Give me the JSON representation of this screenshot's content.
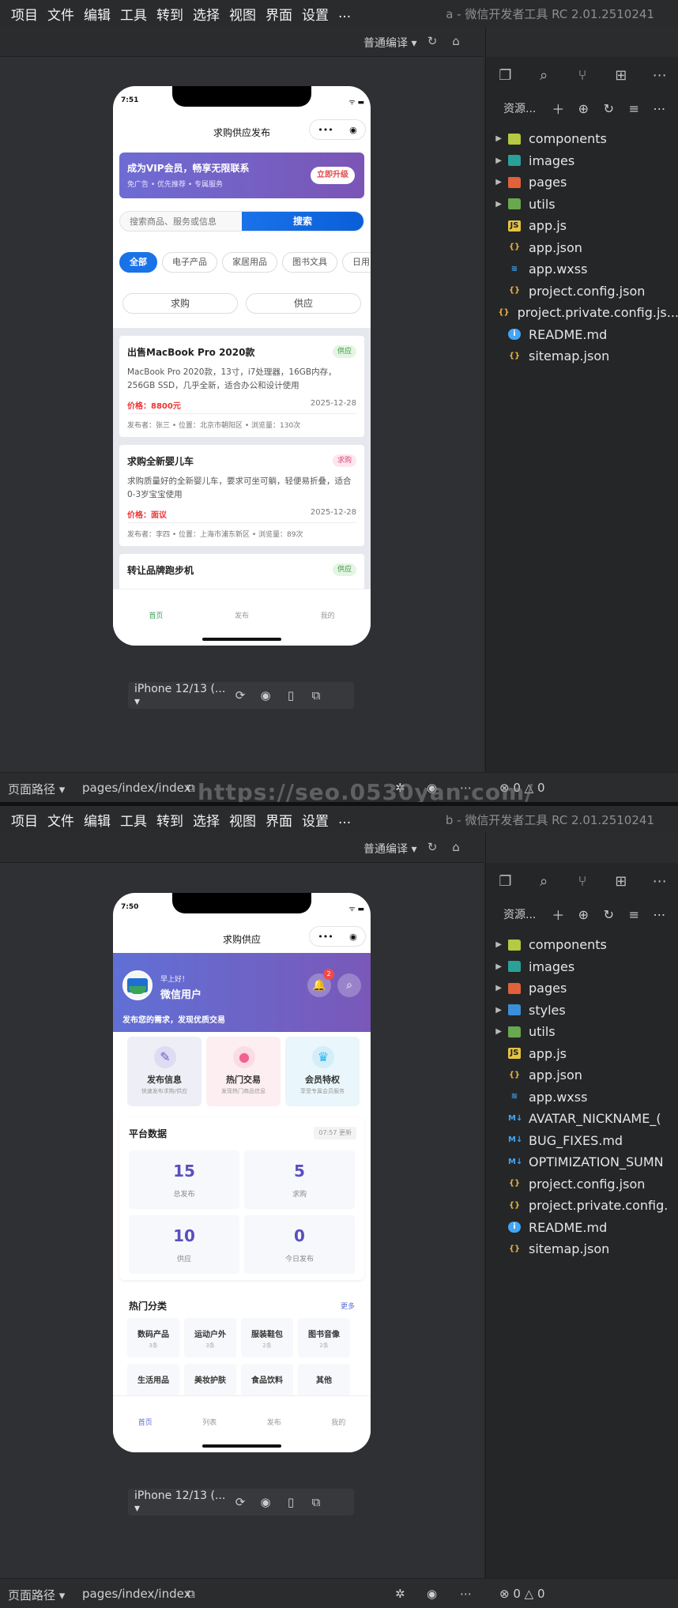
{
  "menu": [
    "项目",
    "文件",
    "编辑",
    "工具",
    "转到",
    "选择",
    "视图",
    "界面",
    "设置",
    "..."
  ],
  "compile_mode": "普通编译",
  "file_panel_title": "资源...",
  "statusbar": {
    "route_label": "页面路径",
    "route": "pages/index/index",
    "problems": "0",
    "warnings": "0"
  },
  "device_name": "iPhone 12/13 (...",
  "watermark": "https://seo.0530yan.com/",
  "window_a": {
    "title": "a - 微信开发者工具 RC 2.01.2510241",
    "files": [
      {
        "name": "components",
        "type": "folder",
        "color": "#b5c942"
      },
      {
        "name": "images",
        "type": "folder",
        "color": "#2aa198"
      },
      {
        "name": "pages",
        "type": "folder",
        "color": "#e0613a"
      },
      {
        "name": "utils",
        "type": "folder",
        "color": "#6aa84f"
      },
      {
        "name": "app.js",
        "type": "js"
      },
      {
        "name": "app.json",
        "type": "json"
      },
      {
        "name": "app.wxss",
        "type": "css"
      },
      {
        "name": "project.config.json",
        "type": "json"
      },
      {
        "name": "project.private.config.js...",
        "type": "json"
      },
      {
        "name": "README.md",
        "type": "info"
      },
      {
        "name": "sitemap.json",
        "type": "json"
      }
    ],
    "phone": {
      "time": "7:51",
      "nav_title": "求购供应发布",
      "vip": {
        "title": "成为VIP会员，畅享无限联系",
        "subtitle": "免广告 • 优先推荐 • 专属服务",
        "button": "立即升级"
      },
      "search": {
        "placeholder": "搜索商品、服务或信息",
        "button": "搜索"
      },
      "categories": [
        "全部",
        "电子产品",
        "家居用品",
        "图书文具",
        "日用"
      ],
      "segments": [
        "求购",
        "供应"
      ],
      "posts": [
        {
          "title": "出售MacBook Pro 2020款",
          "tag": "供应",
          "desc": "MacBook Pro 2020款，13寸，i7处理器，16GB内存，256GB SSD，几乎全新，适合办公和设计使用",
          "price": "价格：8800元",
          "date": "2025-12-28",
          "meta": "发布者：张三 • 位置：北京市朝阳区 • 浏览量：130次"
        },
        {
          "title": "求购全新婴儿车",
          "tag": "求购",
          "desc": "求购质量好的全新婴儿车，要求可坐可躺，轻便易折叠，适合0-3岁宝宝使用",
          "price": "价格：面议",
          "date": "2025-12-28",
          "meta": "发布者：李四 • 位置：上海市浦东新区 • 浏览量：89次"
        },
        {
          "title": "转让品牌跑步机",
          "tag": "供应",
          "desc": "",
          "price": "",
          "date": "",
          "meta": ""
        }
      ],
      "tabs": [
        "首页",
        "发布",
        "我的"
      ]
    }
  },
  "window_b": {
    "title": "b - 微信开发者工具 RC 2.01.2510241",
    "files": [
      {
        "name": "components",
        "type": "folder",
        "color": "#b5c942"
      },
      {
        "name": "images",
        "type": "folder",
        "color": "#2aa198"
      },
      {
        "name": "pages",
        "type": "folder",
        "color": "#e0613a"
      },
      {
        "name": "styles",
        "type": "folder",
        "color": "#3b8fd9"
      },
      {
        "name": "utils",
        "type": "folder",
        "color": "#6aa84f"
      },
      {
        "name": "app.js",
        "type": "js"
      },
      {
        "name": "app.json",
        "type": "json"
      },
      {
        "name": "app.wxss",
        "type": "css"
      },
      {
        "name": "AVATAR_NICKNAME_(",
        "type": "md"
      },
      {
        "name": "BUG_FIXES.md",
        "type": "md"
      },
      {
        "name": "OPTIMIZATION_SUMN",
        "type": "md"
      },
      {
        "name": "project.config.json",
        "type": "json"
      },
      {
        "name": "project.private.config.",
        "type": "json"
      },
      {
        "name": "README.md",
        "type": "info"
      },
      {
        "name": "sitemap.json",
        "type": "json"
      }
    ],
    "phone": {
      "time": "7:50",
      "nav_title": "求购供应",
      "hero": {
        "greeting": "早上好！",
        "username": "微信用户",
        "slogan": "发布您的需求，发现优质交易",
        "badge": "2"
      },
      "quick": [
        {
          "title": "发布信息",
          "sub": "快速发布求购/供应",
          "bg": "#eeeef6",
          "iconbg": "#dedcf2",
          "icon": "✎",
          "iconcolor": "#6a5fc7"
        },
        {
          "title": "热门交易",
          "sub": "发现热门商品信息",
          "bg": "#fdeef2",
          "iconbg": "#fbdbe4",
          "icon": "●",
          "iconcolor": "#f06292"
        },
        {
          "title": "会员特权",
          "sub": "享受专属会员服务",
          "bg": "#e9f6fb",
          "iconbg": "#d4eef8",
          "icon": "♛",
          "iconcolor": "#29b6f6"
        }
      ],
      "stats": {
        "title": "平台数据",
        "updated": "07:57 更新",
        "items": [
          {
            "value": "15",
            "label": "总发布"
          },
          {
            "value": "5",
            "label": "求购"
          },
          {
            "value": "10",
            "label": "供应"
          },
          {
            "value": "0",
            "label": "今日发布"
          }
        ]
      },
      "hot": {
        "title": "热门分类",
        "more": "更多",
        "items": [
          {
            "name": "数码产品",
            "count": "3条"
          },
          {
            "name": "运动户外",
            "count": "3条"
          },
          {
            "name": "服装鞋包",
            "count": "2条"
          },
          {
            "name": "图书音像",
            "count": "2条"
          },
          {
            "name": "生活用品",
            "count": ""
          },
          {
            "name": "美妆护肤",
            "count": ""
          },
          {
            "name": "食品饮料",
            "count": ""
          },
          {
            "name": "其他",
            "count": ""
          }
        ]
      },
      "tabs": [
        "首页",
        "列表",
        "发布",
        "我的"
      ]
    }
  }
}
